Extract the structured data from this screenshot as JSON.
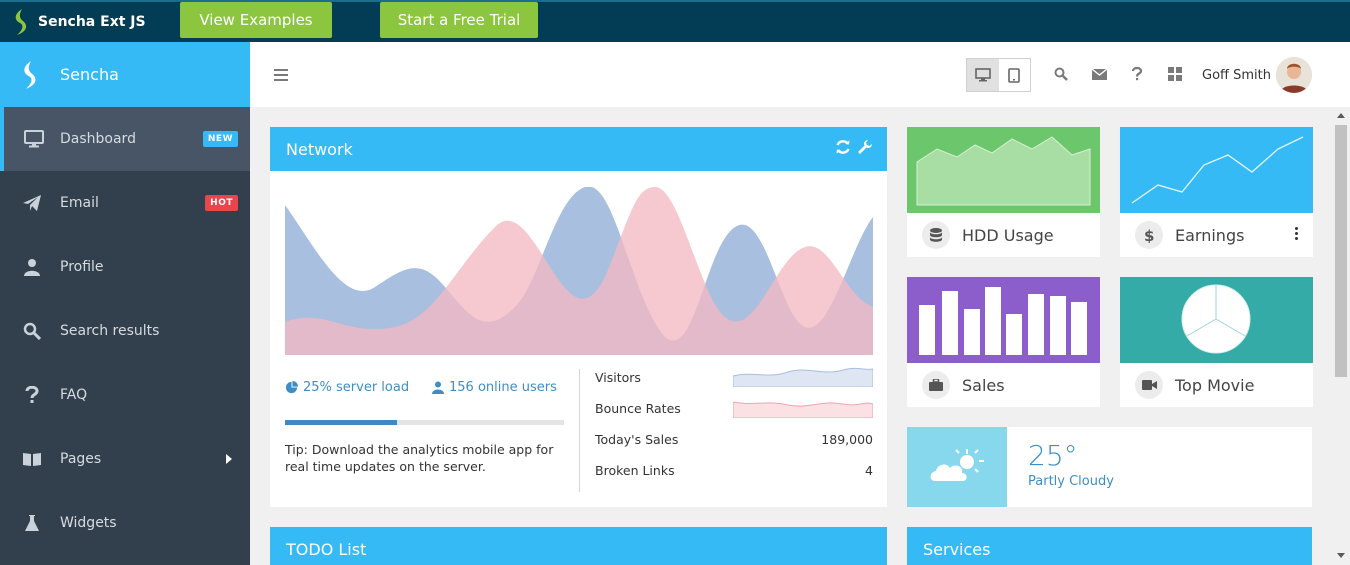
{
  "promo": {
    "brand": "Sencha Ext JS",
    "view_examples": "View Examples",
    "free_trial": "Start a Free Trial"
  },
  "app": {
    "name": "Sencha"
  },
  "sidebar": {
    "items": [
      {
        "label": "Dashboard",
        "icon": "monitor-icon",
        "badge": "NEW"
      },
      {
        "label": "Email",
        "icon": "paper-plane-icon",
        "badge": "HOT"
      },
      {
        "label": "Profile",
        "icon": "user-icon"
      },
      {
        "label": "Search results",
        "icon": "search-icon"
      },
      {
        "label": "FAQ",
        "icon": "question-icon"
      },
      {
        "label": "Pages",
        "icon": "book-icon"
      },
      {
        "label": "Widgets",
        "icon": "flask-icon"
      }
    ]
  },
  "header": {
    "user_name": "Goff Smith"
  },
  "network": {
    "title": "Network",
    "server_load": "25% server load",
    "server_load_fraction": 0.4,
    "online_users": "156 online users",
    "tip": "Tip: Download the analytics mobile app for real time updates on the server.",
    "metrics": [
      {
        "label": "Visitors",
        "value": ""
      },
      {
        "label": "Bounce Rates",
        "value": ""
      },
      {
        "label": "Today's Sales",
        "value": "189,000"
      },
      {
        "label": "Broken Links",
        "value": "4"
      }
    ]
  },
  "tiles": {
    "hdd": "HDD Usage",
    "earnings": "Earnings",
    "sales": "Sales",
    "movie": "Top Movie"
  },
  "weather": {
    "temp": "25°",
    "desc": "Partly Cloudy"
  },
  "todo": {
    "title": "TODO List"
  },
  "services": {
    "title": "Services"
  },
  "colors": {
    "accent": "#35baf6",
    "sidebar": "#32404e",
    "hdd_green": "#6cc76c",
    "sales_purple": "#8b5ecb",
    "movie_teal": "#34aba6",
    "weather_blue": "#87d8ec",
    "series_blue": "#9fb8dd",
    "series_pink": "#f3b9c3"
  }
}
